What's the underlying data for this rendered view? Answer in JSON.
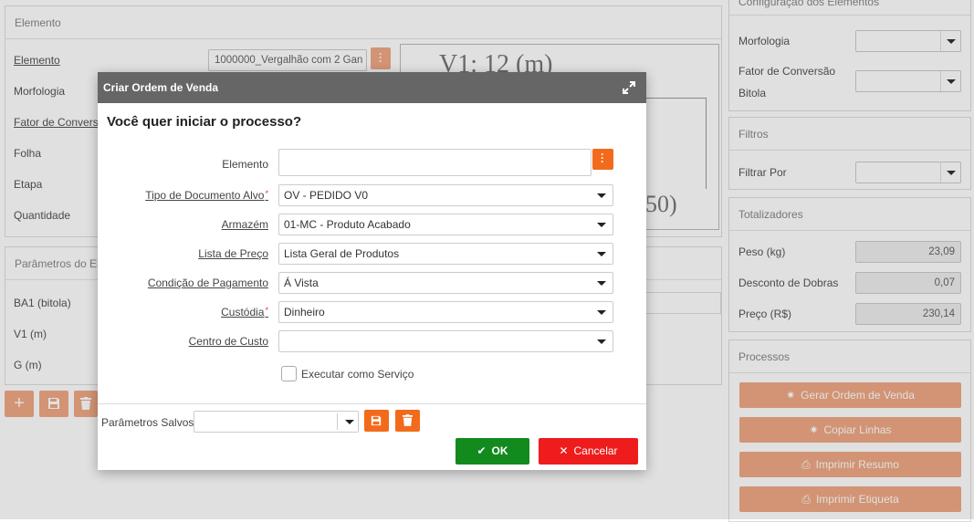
{
  "left_panel": {
    "title": "Elemento",
    "elemento_label": "Elemento",
    "elemento_value": "1000000_Vergalhão com 2 Gan",
    "morfologia_label": "Morfologia",
    "fator_label": "Fator de Conversão",
    "folha_label": "Folha",
    "etapa_label": "Etapa",
    "quantidade_label": "Quantidade"
  },
  "drawing": {
    "top_text": "V1: 12 (m)",
    "side_text": "50)"
  },
  "params_panel": {
    "title": "Parâmetros do Ele",
    "rows": [
      "BA1 (bitola)",
      "V1 (m)",
      "G (m)"
    ]
  },
  "right": {
    "config_title": "Configuração dos Elementos",
    "morfologia_label": "Morfologia",
    "fator_label": "Fator de Conversão",
    "bitola_label": "Bitola",
    "filtros_title": "Filtros",
    "filtrar_label": "Filtrar Por",
    "totalizadores_title": "Totalizadores",
    "peso_label": "Peso (kg)",
    "peso_value": "23,09",
    "desconto_label": "Desconto de Dobras",
    "desconto_value": "0,07",
    "preco_label": "Preço (R$)",
    "preco_value": "230,14",
    "processos_title": "Processos",
    "btn_gerar": "Gerar Ordem de Venda",
    "btn_copiar": "Copiar Linhas",
    "btn_resumo": "Imprimir Resumo",
    "btn_etiqueta": "Imprimir Etiqueta"
  },
  "modal": {
    "title": "Criar Ordem de Venda",
    "question": "Você quer iniciar o processo?",
    "elemento_label": "Elemento",
    "tipo_label": "Tipo de Documento Alvo",
    "tipo_value": "OV - PEDIDO V0",
    "armazem_label": "Armazém",
    "armazem_value": "01-MC - Produto Acabado",
    "lista_label": "Lista de Preço",
    "lista_value": "Lista Geral de Produtos",
    "condicao_label": "Condição de Pagamento",
    "condicao_value": "Á Vista",
    "custodia_label": "Custódia",
    "custodia_value": "Dinheiro",
    "centro_label": "Centro de Custo",
    "executar_label": "Executar como Serviço",
    "parametros_label": "Parâmetros Salvos",
    "ok_label": "OK",
    "cancel_label": "Cancelar"
  },
  "colors": {
    "accent": "#f26b1d",
    "ok": "#128a1e",
    "cancel": "#ee1c1c",
    "proc": "#f0a984"
  }
}
